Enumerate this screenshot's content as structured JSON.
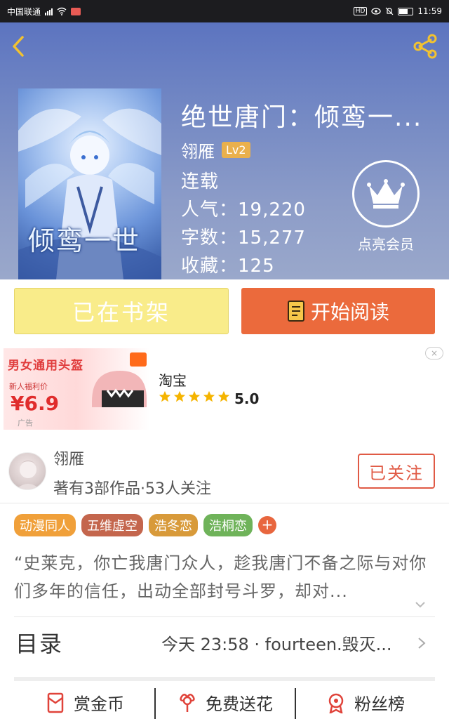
{
  "status_bar": {
    "carrier": "中国联通",
    "time": "11:59"
  },
  "book": {
    "title": "绝世唐门：倾鸾一...",
    "author": "翎雁",
    "level_badge": "Lv2",
    "status": "连载",
    "popularity": "人气：19,220",
    "word_count": "字数：15,277",
    "favorites": "收藏：125",
    "cover_text": "倾鸾一世"
  },
  "vip": {
    "label": "点亮会员"
  },
  "actions": {
    "shelf_label": "已在书架",
    "read_label": "开始阅读"
  },
  "ad": {
    "image_headline": "男女通用头盔",
    "image_price": "¥6.9",
    "image_sub": "新人福利价",
    "brand": "淘宝",
    "rating": "5.0",
    "stars": 5,
    "tag": "广告",
    "close": "×"
  },
  "author_card": {
    "name": "翎雁",
    "works": "著有3部作品·53人关注",
    "follow_label": "已关注"
  },
  "tags": [
    {
      "label": "动漫同人",
      "color": "#f0a03a"
    },
    {
      "label": "五维虚空",
      "color": "#c4664d"
    },
    {
      "label": "浩冬恋",
      "color": "#d89a3a"
    },
    {
      "label": "浩桐恋",
      "color": "#6fb35a"
    }
  ],
  "tag_more": "+",
  "description": "“史莱克，你亡我唐门众人，趁我唐门不备之际与对你们多年的信任，出动全部封号斗罗，却对...",
  "toc": {
    "label": "目录",
    "latest": "今天 23:58 · fourteen.毁灭..."
  },
  "bottom_actions": [
    {
      "label": "赏金币",
      "icon": "red-envelope-icon"
    },
    {
      "label": "免费送花",
      "icon": "flower-icon"
    },
    {
      "label": "粉丝榜",
      "icon": "medal-icon"
    }
  ],
  "colors": {
    "header_start": "#5c74c0",
    "read_button": "#eb6a3c",
    "shelf_button": "#f9ec8a",
    "follow": "#e05a45"
  }
}
